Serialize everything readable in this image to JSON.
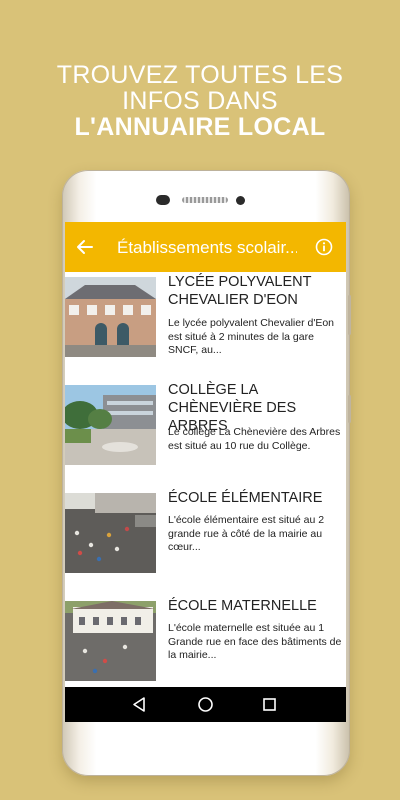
{
  "headline": {
    "line1": "TROUVEZ TOUTES LES",
    "line2": "INFOS DANS",
    "line3": "L'ANNUAIRE LOCAL"
  },
  "app": {
    "title": "Établissements scolair...",
    "accent": "#f3b700",
    "back_icon": "arrow-left-icon",
    "info_icon": "info-circle-icon"
  },
  "items": [
    {
      "title": "LYCÉE POLYVALENT CHEVALIER D'EON",
      "description": "Le lycée polyvalent Chevalier d'Eon est situé à 2 minutes de la gare SNCF, au..."
    },
    {
      "title": "COLLÈGE LA CHÈNEVIÈRE DES ARBRES",
      "description": "Le collège La Chènevière des Arbres est situé au 10 rue du Collège."
    },
    {
      "title": "ÉCOLE ÉLÉMENTAIRE",
      "description": "L'école élémentaire est situé au 2 grande rue à côté de la mairie au cœur..."
    },
    {
      "title": "ÉCOLE MATERNELLE",
      "description": "L'école maternelle est située au 1 Grande rue en face des bâtiments de la mairie..."
    }
  ],
  "navbar": {
    "back": "triangle-back-icon",
    "home": "circle-home-icon",
    "recents": "square-recents-icon"
  }
}
